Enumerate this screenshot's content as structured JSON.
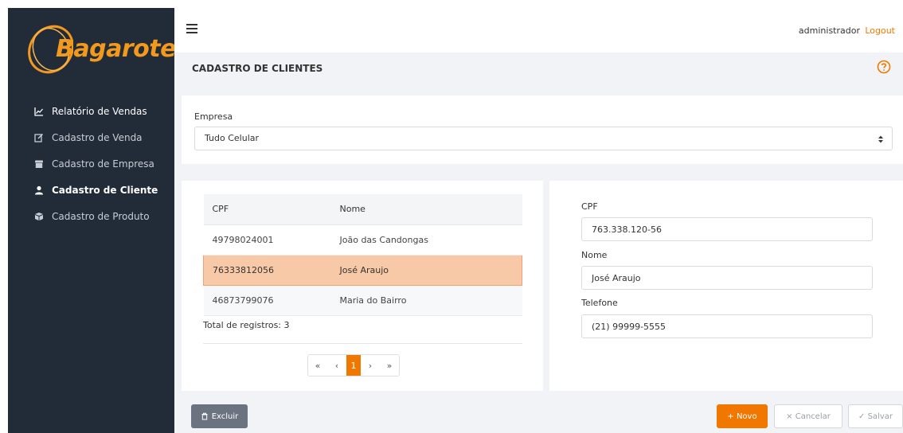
{
  "brand": {
    "logo_text": "Bagarote",
    "logo_color": "#f39a1e"
  },
  "sidebar": {
    "items": [
      {
        "label": "Relatório de Vendas",
        "icon": "chart-line-icon"
      },
      {
        "label": "Cadastro de Venda",
        "icon": "edit-icon"
      },
      {
        "label": "Cadastro de Empresa",
        "icon": "store-icon"
      },
      {
        "label": "Cadastro de Cliente",
        "icon": "user-icon",
        "active": true
      },
      {
        "label": "Cadastro de Produto",
        "icon": "box-icon"
      }
    ]
  },
  "header": {
    "user": "administrador",
    "logout": "Logout"
  },
  "page": {
    "title": "CADASTRO DE CLIENTES",
    "help_icon": "help-circle-icon"
  },
  "empresa": {
    "label": "Empresa",
    "selected": "Tudo Celular"
  },
  "list": {
    "columns": [
      "CPF",
      "Nome"
    ],
    "rows": [
      {
        "cpf": "49798024001",
        "nome": "João das Candongas"
      },
      {
        "cpf": "76333812056",
        "nome": "José Araujo",
        "selected": true
      },
      {
        "cpf": "46873799076",
        "nome": "Maria do Bairro"
      }
    ],
    "total": "Total de registros: 3",
    "pager": {
      "first": "«",
      "prev": "‹",
      "current": "1",
      "next": "›",
      "last": "»"
    }
  },
  "form": {
    "cpf_label": "CPF",
    "cpf_value": "763.338.120-56",
    "nome_label": "Nome",
    "nome_value": "José Araujo",
    "telefone_label": "Telefone",
    "telefone_value": "(21) 99999-5555"
  },
  "actions": {
    "excluir": "Excluir",
    "novo": "+ Novo",
    "cancelar": "× Cancelar",
    "salvar": "✓ Salvar"
  },
  "colors": {
    "accent": "#f07800",
    "sidebar_bg": "#222b38",
    "selected_row": "#f8c9a6"
  }
}
